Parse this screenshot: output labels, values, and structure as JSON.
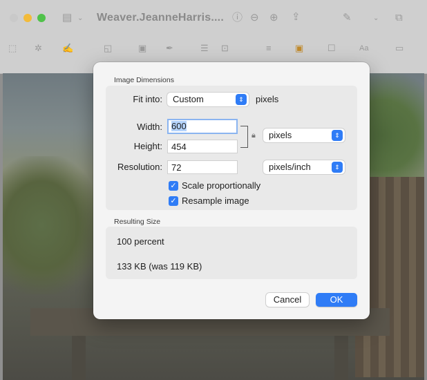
{
  "window": {
    "title": "Weaver.JeanneHarris....",
    "colors": {
      "accent": "#2f7cf6",
      "traffic_yellow": "#f3bb3a",
      "traffic_green": "#50c24a"
    }
  },
  "toolbar": {
    "row1_icons": [
      "sidebar-icon",
      "chevron-down-icon",
      "info-icon",
      "zoom-out-icon",
      "zoom-in-icon",
      "share-icon",
      "markup-pen-icon",
      "chevron-down-icon",
      "window-icon"
    ],
    "row2_icons": [
      "rect-selection-icon",
      "instant-alpha-icon",
      "sketch-icon",
      "shapes-icon",
      "text-icon",
      "sign-icon",
      "adjust-color-icon",
      "adjust-size-icon",
      "align-icon",
      "border-color-icon",
      "fill-color-icon",
      "text-style-icon",
      "note-icon"
    ],
    "text_style_label": "Aa"
  },
  "dialog": {
    "image_dimensions_title": "Image Dimensions",
    "fit_into_label": "Fit into:",
    "fit_into_value": "Custom",
    "fit_into_unit": "pixels",
    "width_label": "Width:",
    "width_value": "600",
    "height_label": "Height:",
    "height_value": "454",
    "dimension_unit": "pixels",
    "resolution_label": "Resolution:",
    "resolution_value": "72",
    "resolution_unit": "pixels/inch",
    "scale_label": "Scale proportionally",
    "resample_label": "Resample image",
    "resulting_size_title": "Resulting Size",
    "percent_text": "100 percent",
    "size_text": "133 KB (was 119 KB)",
    "cancel_label": "Cancel",
    "ok_label": "OK"
  }
}
